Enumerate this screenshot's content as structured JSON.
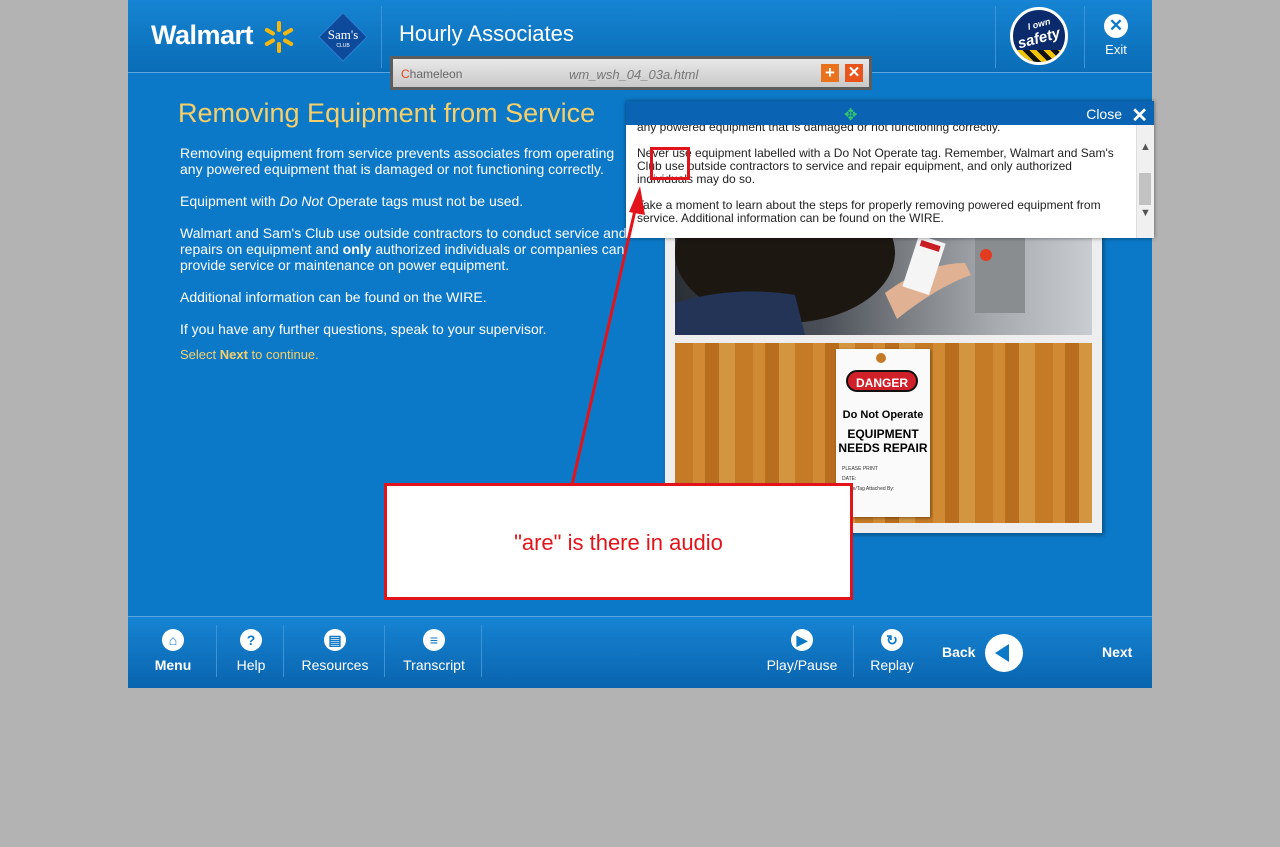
{
  "header": {
    "brand_walmart": "Walmart",
    "brand_sams": "Sam's",
    "brand_sams_sub": "CLUB",
    "course_title": "Hourly Associates",
    "safety_badge_top": "I own",
    "safety_badge_main": "safety",
    "exit_label": "Exit"
  },
  "chameleon_bar": {
    "logo_text": "hameleon",
    "filename": "wm_wsh_04_03a.html"
  },
  "content": {
    "title": "Removing Equipment from Service",
    "p1": "Removing equipment from service prevents associates from operating any powered equipment that is damaged or not functioning correctly.",
    "p2_pre": "Equipment with ",
    "p2_em": "Do Not",
    "p2_post": " Operate tags must not be used.",
    "p3_pre": "Walmart and Sam's Club use outside contractors to conduct service and repairs on equipment and ",
    "p3_bold": "only",
    "p3_post": " authorized individuals or companies can provide service or maintenance on power equipment.",
    "p4": "Additional information can be found on the WIRE.",
    "p5": "If you have any further questions, speak to your supervisor.",
    "select_pre": "Select ",
    "select_bold": "Next",
    "select_post": " to continue."
  },
  "tag_image": {
    "danger": "DANGER",
    "do_not_operate": "Do Not Operate",
    "equipment": "EQUIPMENT",
    "needs_repair": "NEEDS REPAIR",
    "line1": "PLEASE PRINT",
    "line2": "DATE:",
    "line3": "Name/Tag Attached By:"
  },
  "transcript": {
    "close_label": "Close",
    "line_top": "any powered equipment that is damaged or not functioning correctly.",
    "para1": "Never use equipment labelled with a Do Not Operate tag.  Remember, Walmart and Sam's Club use outside contractors to service and repair equipment, and only authorized individuals may do so.",
    "para2": "Take a moment to learn about the steps for properly removing powered equipment from service.  Additional information can be found on the WIRE."
  },
  "annotation": {
    "callout_text": "\"are\" is there in audio",
    "color": "#e3131b"
  },
  "footer": {
    "menu": "Menu",
    "help": "Help",
    "resources": "Resources",
    "transcript": "Transcript",
    "play_pause": "Play/Pause",
    "replay": "Replay",
    "back": "Back",
    "next": "Next"
  },
  "colors": {
    "background": "#b3b3b3",
    "app_blue": "#0b79c8",
    "title_gold": "#f6cf6a"
  }
}
